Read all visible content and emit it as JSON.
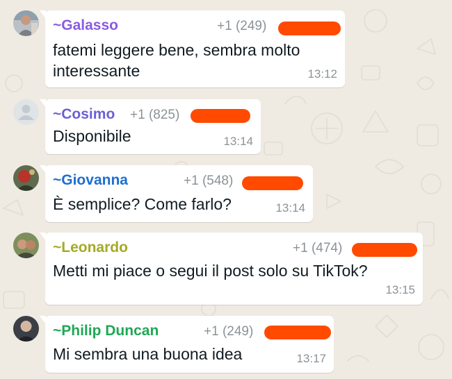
{
  "colors": {
    "background": "#efeae2",
    "bubble": "#ffffff",
    "message_text": "#111b21",
    "meta_text": "#8c9297",
    "redaction": "#ff4a00"
  },
  "messages": [
    {
      "avatar_icon": "profile-photo",
      "sender": "~Galasso",
      "sender_color": "#8a5be2",
      "phone": "+1 (249)",
      "text_lines": [
        "fatemi leggere bene, sembra molto",
        "interessante"
      ],
      "time": "13:12"
    },
    {
      "avatar_icon": "default-profile-icon",
      "sender": "~Cosimo",
      "sender_color": "#6c5fd6",
      "phone": "+1 (825)",
      "text_lines": [
        "Disponibile"
      ],
      "time": "13:14"
    },
    {
      "avatar_icon": "profile-photo",
      "sender": "~Giovanna",
      "sender_color": "#1e6fcf",
      "phone": "+1 (548)",
      "text_lines": [
        "È semplice? Come farlo?"
      ],
      "time": "13:14"
    },
    {
      "avatar_icon": "profile-photo",
      "sender": "~Leonardo",
      "sender_color": "#a3ab24",
      "phone": "+1 (474)",
      "text_lines": [
        "Metti mi piace o segui il post solo su TikTok?"
      ],
      "time": "13:15"
    },
    {
      "avatar_icon": "profile-photo",
      "sender": "~Philip Duncan",
      "sender_color": "#1fa855",
      "phone": "+1 (249)",
      "text_lines": [
        "Mi sembra una buona idea"
      ],
      "time": "13:17"
    }
  ]
}
